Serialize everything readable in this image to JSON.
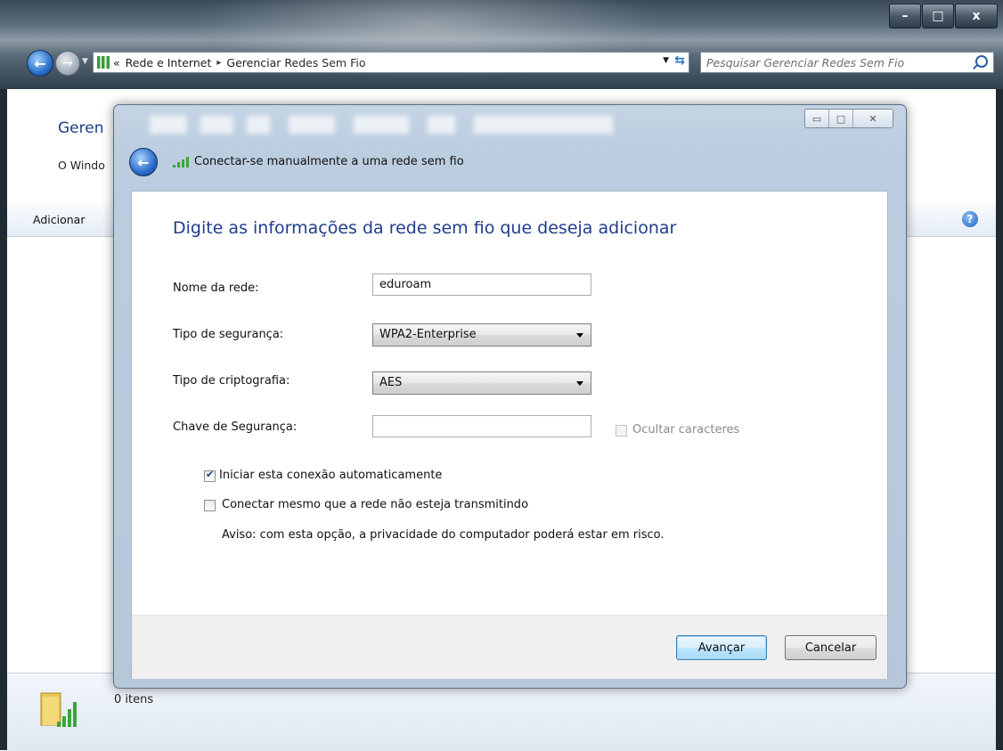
{
  "explorer": {
    "breadcrumb": {
      "overflow": "«",
      "items": [
        "Rede e Internet",
        "Gerenciar Redes Sem Fio"
      ],
      "separator": "▸"
    },
    "search_placeholder": "Pesquisar Gerenciar Redes Sem Fio",
    "title_partial": "Geren",
    "subtitle_partial": "O Windo",
    "toolbar_add": "Adicionar",
    "item_count": "0 itens",
    "window_controls": {
      "minimize": "–",
      "maximize": "□",
      "close": "x"
    }
  },
  "dialog": {
    "title": "Conectar-se manualmente a uma rede sem fio",
    "heading": "Digite as informações da rede sem fio que deseja adicionar",
    "fields": {
      "network_name": {
        "label": "Nome da rede:",
        "value": "eduroam"
      },
      "security_type": {
        "label": "Tipo de segurança:",
        "value": "WPA2-Enterprise"
      },
      "encryption_type": {
        "label": "Tipo de criptografia:",
        "value": "AES"
      },
      "security_key": {
        "label": "Chave de Segurança:",
        "value": ""
      }
    },
    "hide_characters": {
      "label": "Ocultar caracteres",
      "checked": false,
      "disabled": true
    },
    "auto_connect": {
      "label": "Iniciar esta conexão automaticamente",
      "checked": true
    },
    "connect_hidden": {
      "label": "Conectar mesmo que a rede não esteja transmitindo",
      "checked": false
    },
    "warning": "Aviso: com esta opção, a privacidade do computador poderá estar em risco.",
    "buttons": {
      "next": "Avançar",
      "cancel": "Cancelar"
    }
  },
  "colors": {
    "heading_blue": "#1f3d8d",
    "dialog_frame": "#bccde0",
    "primary_button": "#bee6fd"
  },
  "icons": [
    "back-arrow-icon",
    "forward-arrow-icon",
    "wireless-signal-icon",
    "search-icon",
    "help-icon",
    "refresh-icon",
    "network-folder-icon"
  ]
}
